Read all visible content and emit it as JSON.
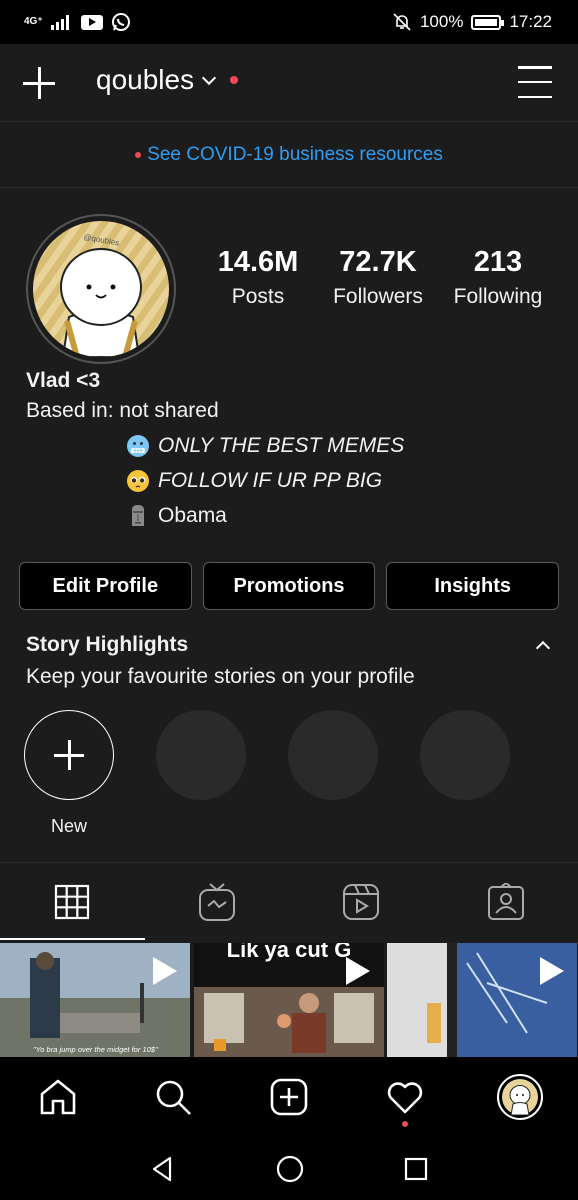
{
  "status_bar": {
    "network": "4G⁺",
    "battery": "100%",
    "time": "17:22"
  },
  "header": {
    "username": "qoubles"
  },
  "banner": {
    "link_text": "See COVID-19 business resources"
  },
  "profile": {
    "avatar_label": "@qoubles",
    "stats": [
      {
        "value": "14.6M",
        "label": "Posts"
      },
      {
        "value": "72.7K",
        "label": "Followers"
      },
      {
        "value": "213",
        "label": "Following"
      }
    ],
    "name": "Vlad <3",
    "location": "Based in: not shared",
    "bio_lines": [
      {
        "text": "ONLY THE BEST MEMES",
        "icon": "cold-face-emoji"
      },
      {
        "text": "FOLLOW IF UR PP BIG",
        "icon": "pleading-face-emoji"
      },
      {
        "text": "Obama",
        "icon": "moai-emoji"
      }
    ]
  },
  "buttons": {
    "edit": "Edit Profile",
    "promotions": "Promotions",
    "insights": "Insights"
  },
  "highlights": {
    "title": "Story Highlights",
    "subtitle": "Keep your favourite stories on your profile",
    "new_label": "New"
  },
  "tabs": [
    "grid-icon",
    "igtv-icon",
    "reels-icon",
    "tagged-icon"
  ],
  "posts": [
    {
      "caption": "\"Yo bra jump over the midget for 10$\""
    },
    {
      "caption": "Lik ya cut G"
    },
    {
      "caption": ""
    }
  ],
  "colors": {
    "accent_link": "#2f9df3",
    "notification_red": "#ed4956",
    "background": "#1c1c1c"
  }
}
